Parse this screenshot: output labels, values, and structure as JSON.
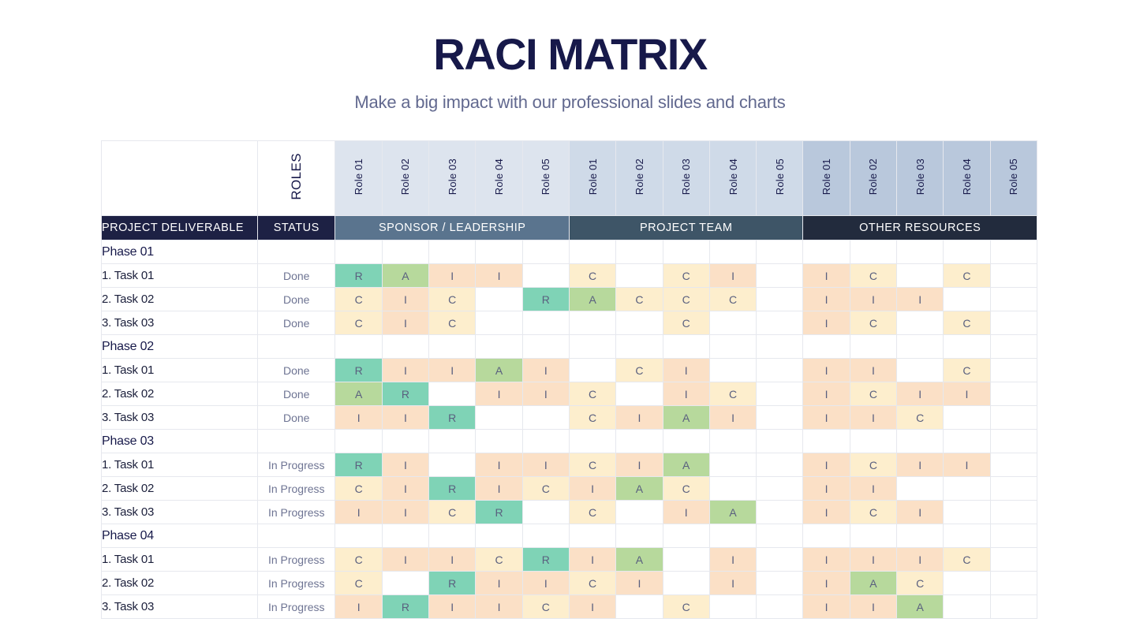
{
  "header": {
    "title": "RACI MATRIX",
    "subtitle": "Make a big impact with our professional slides and charts"
  },
  "table": {
    "corner_label": "",
    "roles_label": "ROLES",
    "col_deliverable": "PROJECT DELIVERABLE",
    "col_status": "STATUS",
    "groups": [
      {
        "name": "SPONSOR / LEADERSHIP",
        "roles": [
          "Role 01",
          "Role 02",
          "Role 03",
          "Role 04",
          "Role 05"
        ]
      },
      {
        "name": "PROJECT TEAM",
        "roles": [
          "Role 01",
          "Role 02",
          "Role 03",
          "Role 04",
          "Role 05"
        ]
      },
      {
        "name": "OTHER RESOURCES",
        "roles": [
          "Role 01",
          "Role 02",
          "Role 03",
          "Role 04",
          "Role 05"
        ]
      }
    ],
    "legend_colors": {
      "R": "#7fd3b6",
      "A": "#b7d99c",
      "I": "#fbe0c6",
      "C": "#fdeecd"
    },
    "rows": [
      {
        "type": "phase",
        "label": "Phase 01",
        "status": "",
        "cells": [
          "",
          "",
          "",
          "",
          "",
          "",
          "",
          "",
          "",
          "",
          "",
          "",
          "",
          "",
          ""
        ]
      },
      {
        "type": "task",
        "label": "1. Task 01",
        "status": "Done",
        "cells": [
          "R",
          "A",
          "I",
          "I",
          "",
          "C",
          "",
          "C",
          "I",
          "",
          "I",
          "C",
          "",
          "C",
          ""
        ]
      },
      {
        "type": "task",
        "label": "2. Task 02",
        "status": "Done",
        "cells": [
          "C",
          "I",
          "C",
          "",
          "R",
          "A",
          "C",
          "C",
          "C",
          "",
          "I",
          "I",
          "I",
          "",
          ""
        ]
      },
      {
        "type": "task",
        "label": "3. Task 03",
        "status": "Done",
        "cells": [
          "C",
          "I",
          "C",
          "",
          "",
          "",
          "",
          "C",
          "",
          "",
          "I",
          "C",
          "",
          "C",
          ""
        ]
      },
      {
        "type": "phase",
        "label": "Phase 02",
        "status": "",
        "cells": [
          "",
          "",
          "",
          "",
          "",
          "",
          "",
          "",
          "",
          "",
          "",
          "",
          "",
          "",
          ""
        ]
      },
      {
        "type": "task",
        "label": "1. Task 01",
        "status": "Done",
        "cells": [
          "R",
          "I",
          "I",
          "A",
          "I",
          "",
          "C",
          "I",
          "",
          "",
          "I",
          "I",
          "",
          "C",
          ""
        ]
      },
      {
        "type": "task",
        "label": "2. Task 02",
        "status": "Done",
        "cells": [
          "A",
          "R",
          "",
          "I",
          "I",
          "C",
          "",
          "I",
          "C",
          "",
          "I",
          "C",
          "I",
          "I",
          ""
        ]
      },
      {
        "type": "task",
        "label": "3. Task 03",
        "status": "Done",
        "cells": [
          "I",
          "I",
          "R",
          "",
          "",
          "C",
          "I",
          "A",
          "I",
          "",
          "I",
          "I",
          "C",
          "",
          ""
        ]
      },
      {
        "type": "phase",
        "label": "Phase 03",
        "status": "",
        "cells": [
          "",
          "",
          "",
          "",
          "",
          "",
          "",
          "",
          "",
          "",
          "",
          "",
          "",
          "",
          ""
        ]
      },
      {
        "type": "task",
        "label": "1. Task 01",
        "status": "In Progress",
        "cells": [
          "R",
          "I",
          "",
          "I",
          "I",
          "C",
          "I",
          "A",
          "",
          "",
          "I",
          "C",
          "I",
          "I",
          ""
        ]
      },
      {
        "type": "task",
        "label": "2. Task 02",
        "status": "In Progress",
        "cells": [
          "C",
          "I",
          "R",
          "I",
          "C",
          "I",
          "A",
          "C",
          "",
          "",
          "I",
          "I",
          "",
          "",
          ""
        ]
      },
      {
        "type": "task",
        "label": "3. Task 03",
        "status": "In Progress",
        "cells": [
          "I",
          "I",
          "C",
          "R",
          "",
          "C",
          "",
          "I",
          "A",
          "",
          "I",
          "C",
          "I",
          "",
          ""
        ]
      },
      {
        "type": "phase",
        "label": "Phase 04",
        "status": "",
        "cells": [
          "",
          "",
          "",
          "",
          "",
          "",
          "",
          "",
          "",
          "",
          "",
          "",
          "",
          "",
          ""
        ]
      },
      {
        "type": "task",
        "label": "1. Task 01",
        "status": "In Progress",
        "cells": [
          "C",
          "I",
          "I",
          "C",
          "R",
          "I",
          "A",
          "",
          "I",
          "",
          "I",
          "I",
          "I",
          "C",
          ""
        ]
      },
      {
        "type": "task",
        "label": "2. Task 02",
        "status": "In Progress",
        "cells": [
          "C",
          "",
          "R",
          "I",
          "I",
          "C",
          "I",
          "",
          "I",
          "",
          "I",
          "A",
          "C",
          "",
          ""
        ]
      },
      {
        "type": "task",
        "label": "3. Task 03",
        "status": "In Progress",
        "cells": [
          "I",
          "R",
          "I",
          "I",
          "C",
          "I",
          "",
          "C",
          "",
          "",
          "I",
          "I",
          "A",
          "",
          ""
        ]
      }
    ]
  }
}
